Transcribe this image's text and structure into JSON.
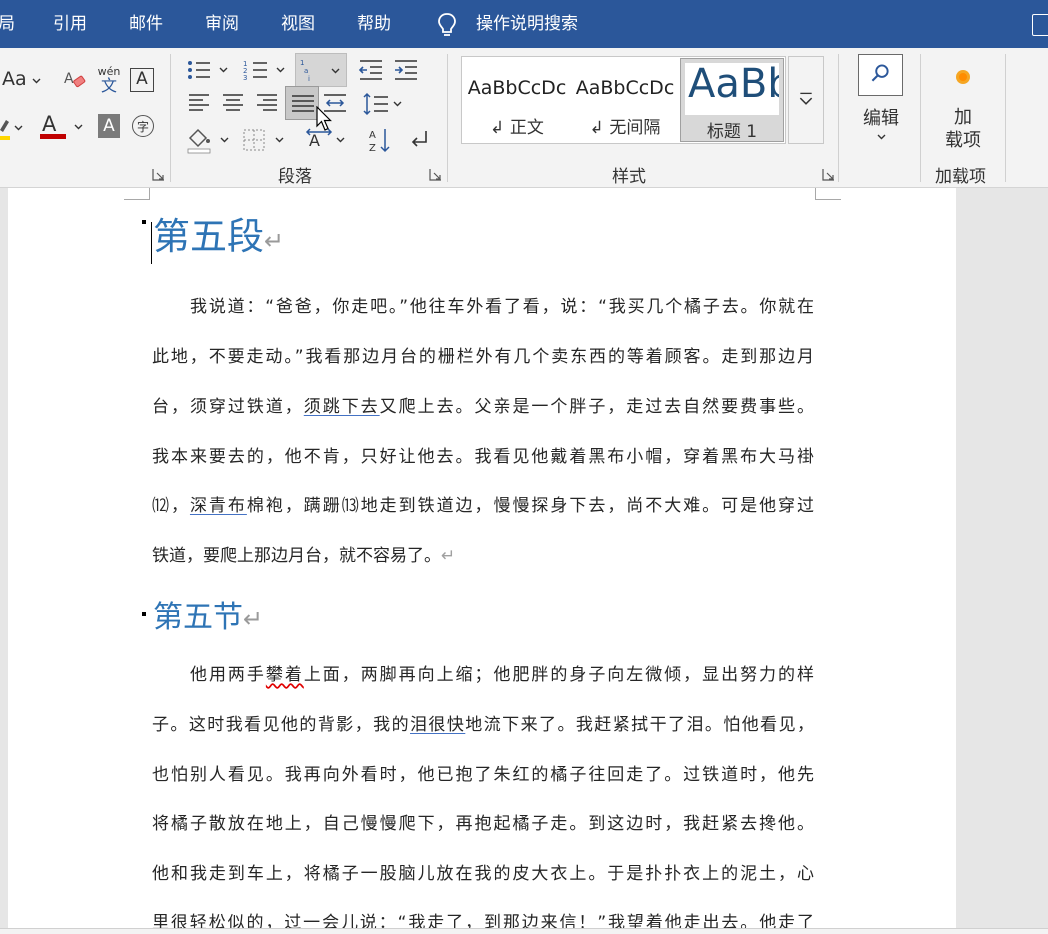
{
  "menubar": {
    "tabs": [
      {
        "label": "局"
      },
      {
        "label": "引用"
      },
      {
        "label": "邮件"
      },
      {
        "label": "审阅"
      },
      {
        "label": "视图"
      },
      {
        "label": "帮助"
      }
    ],
    "search_label": "操作说明搜索",
    "bg_color": "#2b579a"
  },
  "ribbon": {
    "font_group": {
      "change_case_label": "Aa",
      "phonetic_top": "wén",
      "phonetic_bottom": "文",
      "char_border_label": "A",
      "font_color_label": "A",
      "char_shading_label": "A",
      "enclose_label": "字",
      "font_color": "#c00000",
      "highlight_color": "#ffd700"
    },
    "paragraph_group": {
      "label": "段落"
    },
    "styles_group": {
      "label": "样式",
      "styles": [
        {
          "preview": "AaBbCcDc",
          "name": "↲ 正文",
          "selected": false
        },
        {
          "preview": "AaBbCcDc",
          "name": "↲ 无间隔",
          "selected": false
        },
        {
          "preview": "AaBb",
          "name": "标题 1",
          "selected": true
        }
      ]
    },
    "editing_group": {
      "label": "编辑"
    },
    "addins_group": {
      "button_line1": "加",
      "button_line2": "载项",
      "label": "加载项"
    }
  },
  "document": {
    "heading1": "第五段",
    "paragraph1": [
      "我说道：“爸爸，你走吧。”他往车外看了看，说：“我买几个橘子去。你就在",
      "此地，不要走动。”我看那边月台的栅栏外有几个卖东西的等着顾客。走到那边月",
      {
        "before": "台，须穿过铁道，",
        "underlined": "须跳下去",
        "after": "又爬上去。父亲是一个胖子，走过去自然要费事些。"
      },
      "我本来要去的，他不肯，只好让他去。我看见他戴着黑布小帽，穿着黑布大马褂",
      {
        "before": "⑿，",
        "underlined": "深青布",
        "after": "棉袍，蹒跚⒀地走到铁道边，慢慢探身下去，尚不大难。可是他穿过"
      },
      "铁道，要爬上那边月台，就不容易了。"
    ],
    "heading2": "第五节",
    "paragraph2": [
      {
        "before": "他用两手",
        "wavy": "攀着",
        "after": "上面，两脚再向上缩；他肥胖的身子向左微倾，显出努力的样"
      },
      {
        "before": "子。这时我看见他的背影，我的",
        "underlined": "泪很快",
        "after": "地流下来了。我赶紧拭干了泪。怕他看见，"
      },
      "也怕别人看见。我再向外看时，他已抱了朱红的橘子往回走了。过铁道时，他先",
      "将橘子散放在地上，自己慢慢爬下，再抱起橘子走。到这边时，我赶紧去搀他。",
      "他和我走到车上，将橘子一股脑儿放在我的皮大衣上。于是扑扑衣上的泥土，心",
      "里很轻松似的，过一会儿说：“我走了，到那边来信！”我望着他走出去。他走了"
    ],
    "return_mark": "↵",
    "heading_color": "#2e74b5"
  }
}
